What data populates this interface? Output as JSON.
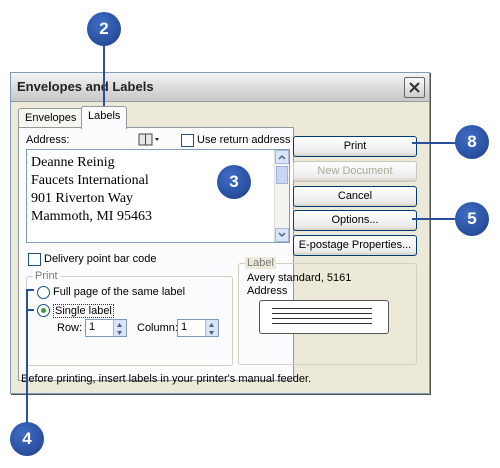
{
  "dialog": {
    "title": "Envelopes and Labels",
    "tabs": [
      {
        "label": "Envelopes"
      },
      {
        "label": "Labels"
      }
    ]
  },
  "address": {
    "label": "Address:",
    "lines": [
      "Deanne Reinig",
      "Faucets International",
      "901 Riverton Way",
      "Mammoth, MI 95463"
    ],
    "use_return_label": "Use return address",
    "use_return_checked": false
  },
  "delivery_barcode": {
    "label": "Delivery point bar code",
    "checked": false
  },
  "print_group": {
    "title": "Print",
    "options": [
      {
        "label": "Full page of the same label",
        "selected": false
      },
      {
        "label": "Single label",
        "selected": true
      }
    ],
    "row_label": "Row:",
    "row_value": "1",
    "column_label": "Column:",
    "column_value": "1"
  },
  "buttons": {
    "print": "Print",
    "new_document": "New Document",
    "cancel": "Cancel",
    "options": "Options...",
    "epostage": "E-postage Properties..."
  },
  "label_group": {
    "title": "Label",
    "name": "Avery standard, 5161",
    "type": "Address"
  },
  "footer_text": "Before printing, insert labels in your printer's manual feeder.",
  "callouts": {
    "c2": "2",
    "c3": "3",
    "c4": "4",
    "c5": "5",
    "c8": "8"
  },
  "colors": {
    "callout": "#2a4f9e",
    "title_bar": "#d8d8d8",
    "dialog_bg": "#ece9d8"
  }
}
